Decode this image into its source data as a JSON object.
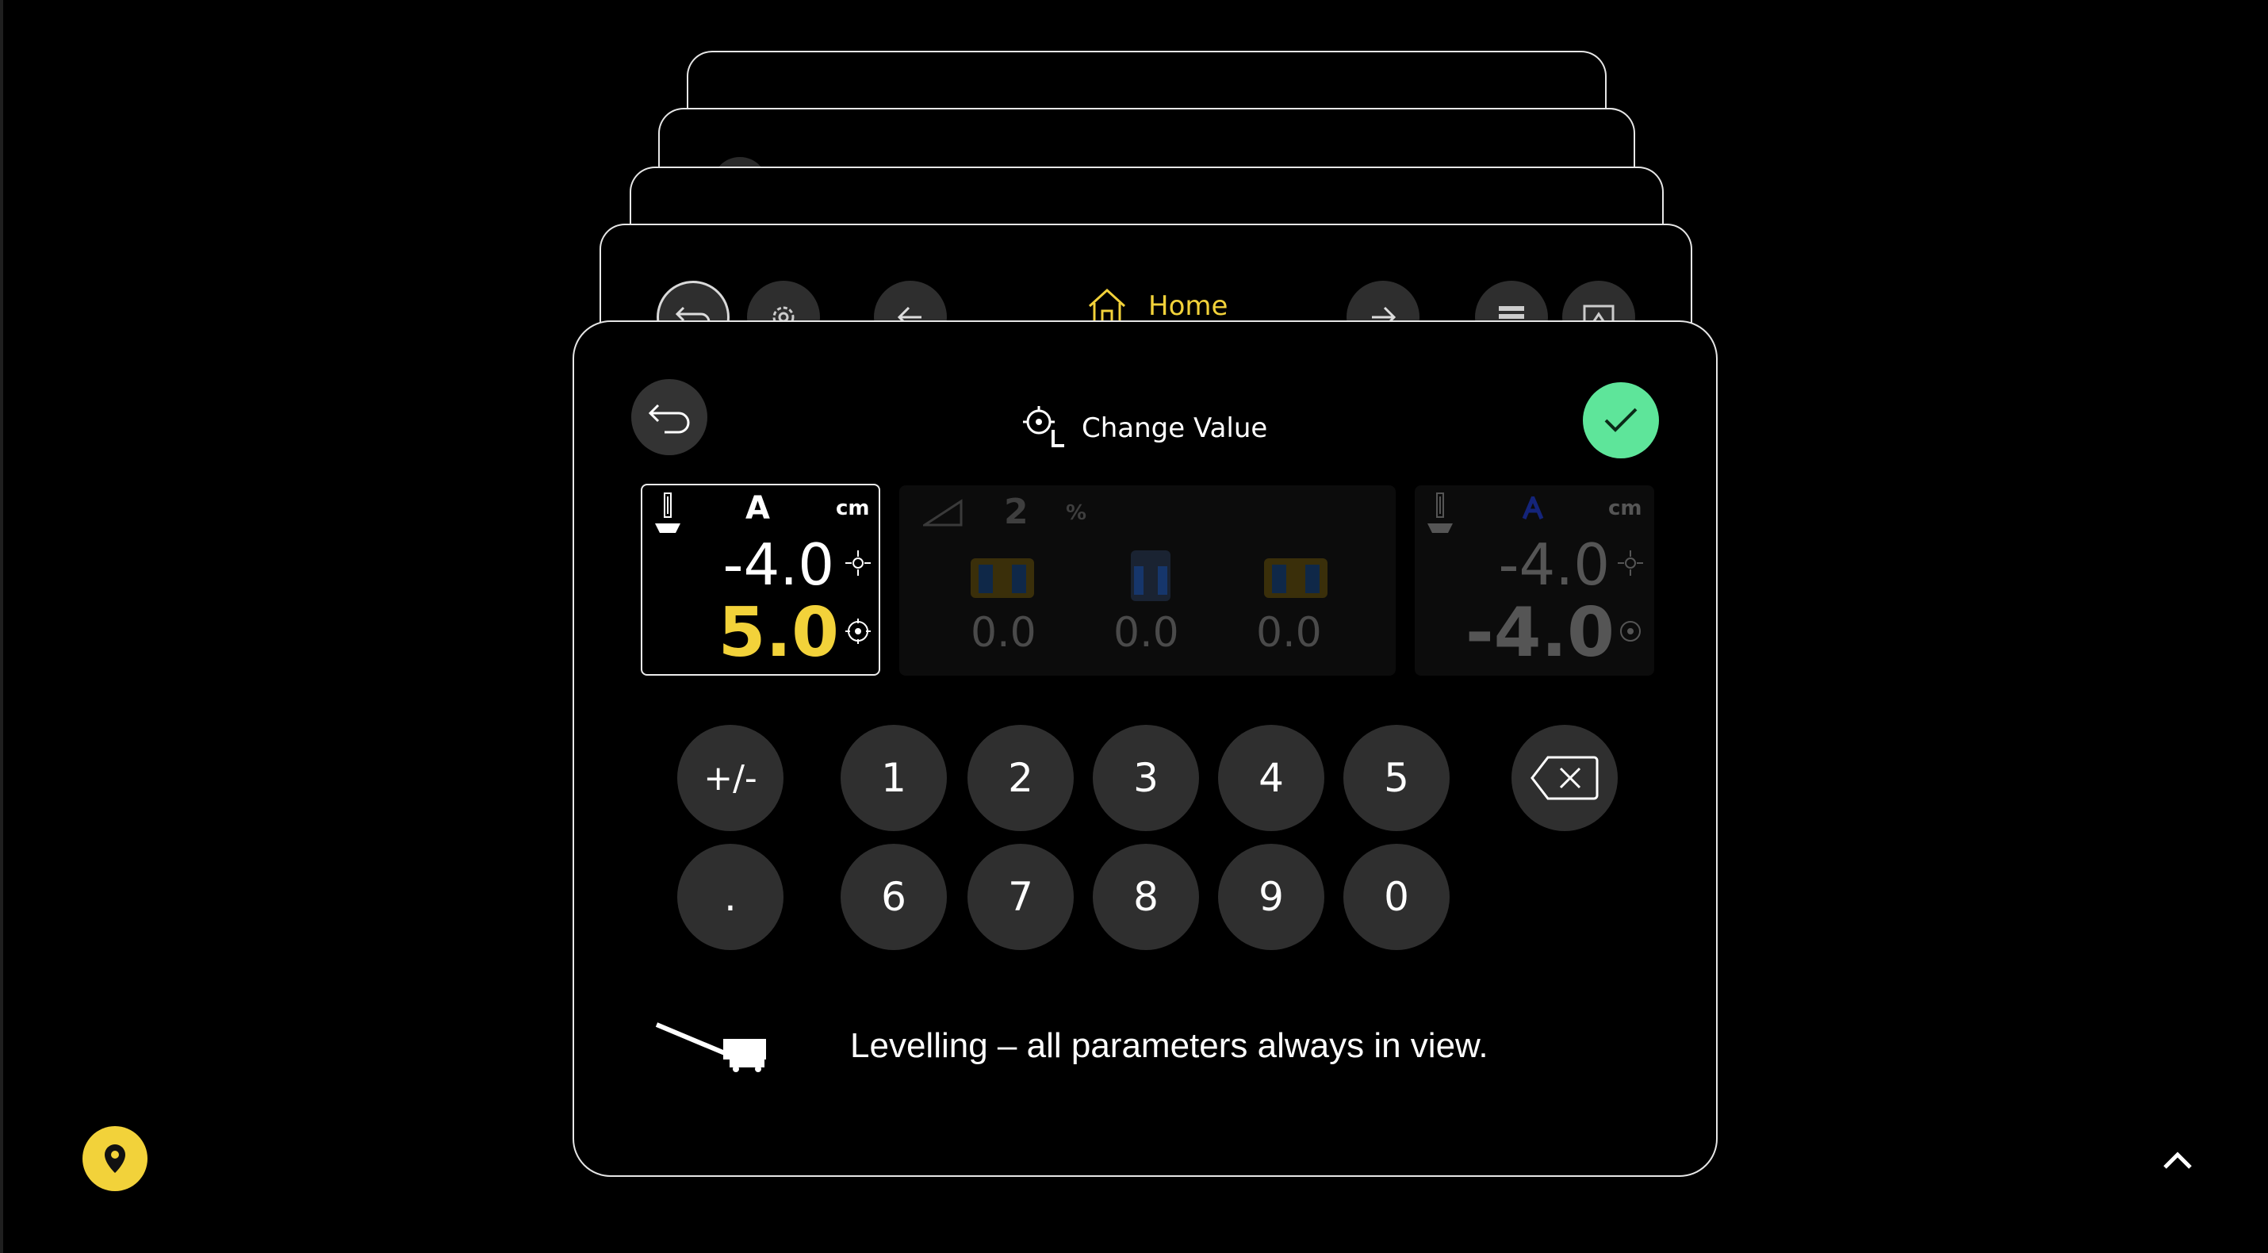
{
  "nav": {
    "home_label": "Home"
  },
  "modal": {
    "title": "Change Value",
    "panel_a": {
      "letter": "A",
      "unit": "cm",
      "current": "-4.0",
      "target": "5.0"
    },
    "panel_slope": {
      "value": "2",
      "unit": "%",
      "readouts": [
        "0.0",
        "0.0",
        "0.0"
      ]
    },
    "panel_right": {
      "unit": "cm",
      "current": "-4.0",
      "target": "-4.0"
    },
    "keypad": {
      "row1": [
        "+/-",
        "1",
        "2",
        "3",
        "4",
        "5"
      ],
      "row2": [
        ".",
        "6",
        "7",
        "8",
        "9",
        "0"
      ]
    },
    "footer_text": "Levelling – all parameters always in view."
  },
  "colors": {
    "accent_yellow": "#f2d23a",
    "confirm_green": "#5ee59a",
    "button_gray": "#2f2f2f"
  },
  "icons": [
    "back-icon",
    "gear-icon",
    "arrow-left-icon",
    "home-icon",
    "arrow-right-icon",
    "layers-icon",
    "screen-icon",
    "target-icon",
    "check-icon",
    "backspace-icon",
    "map-pin-icon",
    "chevron-up-icon",
    "milling-machine-icon"
  ]
}
